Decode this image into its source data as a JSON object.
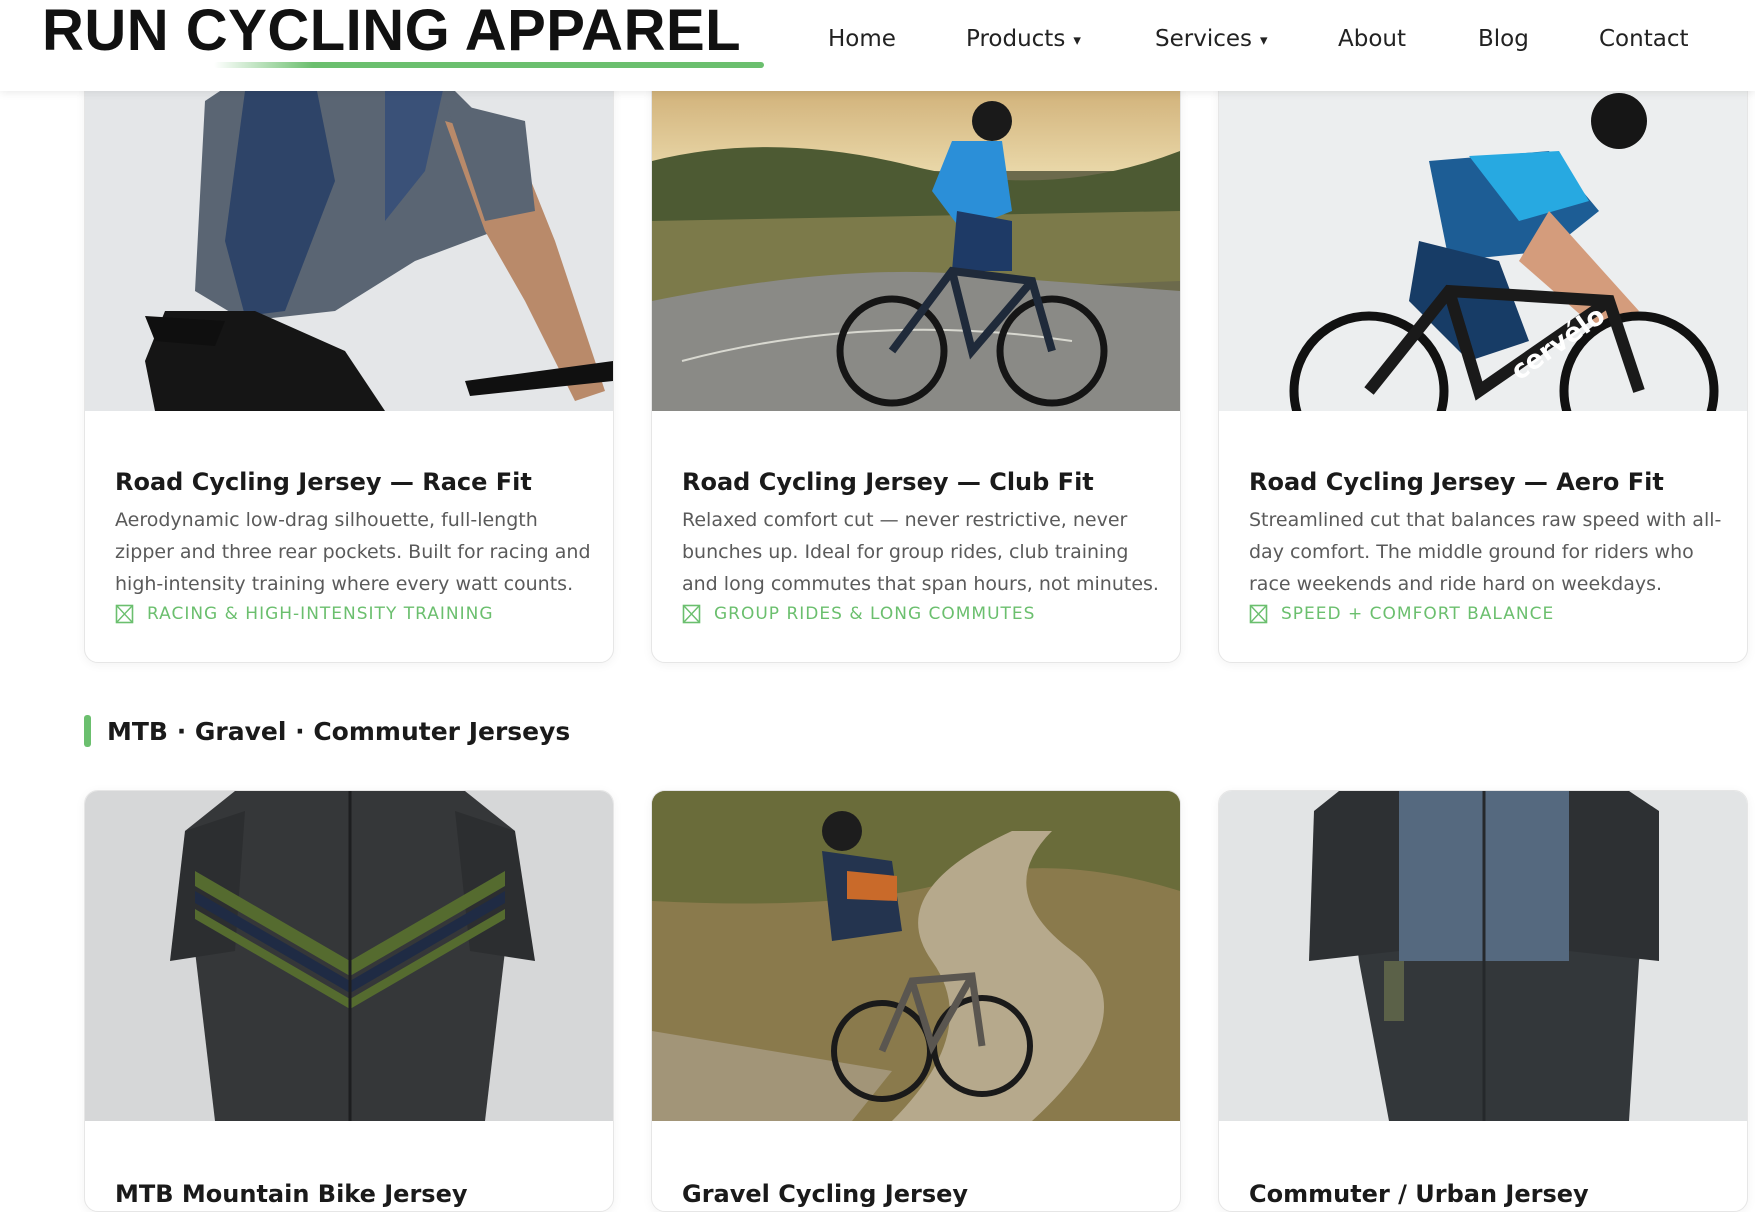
{
  "header": {
    "logo": "RUN CYCLING APPAREL",
    "nav": [
      {
        "label": "Home",
        "has_dropdown": false
      },
      {
        "label": "Products",
        "has_dropdown": true
      },
      {
        "label": "Services",
        "has_dropdown": true
      },
      {
        "label": "About",
        "has_dropdown": false
      },
      {
        "label": "Blog",
        "has_dropdown": false
      },
      {
        "label": "Contact",
        "has_dropdown": false
      }
    ],
    "dropdown_caret": "▾"
  },
  "road_cards": [
    {
      "title": "Road Cycling Jersey — Race Fit",
      "description": "Aerodynamic low-drag silhouette, full-length zipper and three rear pockets. Built for racing and high-intensity training where every watt counts.",
      "tag": "RACING & HIGH-INTENSITY TRAINING"
    },
    {
      "title": "Road Cycling Jersey — Club Fit",
      "description": "Relaxed comfort cut — never restrictive, never bunches up. Ideal for group rides, club training and long commutes that span hours, not minutes.",
      "tag": "GROUP RIDES & LONG COMMUTES"
    },
    {
      "title": "Road Cycling Jersey — Aero Fit",
      "description": "Streamlined cut that balances raw speed with all-day comfort. The middle ground for riders who race weekends and ride hard on weekdays.",
      "tag": "SPEED + COMFORT BALANCE"
    }
  ],
  "section": {
    "title": "MTB · Gravel · Commuter Jerseys"
  },
  "mtb_cards": [
    {
      "title": "MTB Mountain Bike Jersey"
    },
    {
      "title": "Gravel Cycling Jersey"
    },
    {
      "title": "Commuter / Urban Jersey"
    }
  ],
  "colors": {
    "accent": "#6bbf6e",
    "text": "#1a1a1a",
    "muted": "#5a5a5a"
  }
}
